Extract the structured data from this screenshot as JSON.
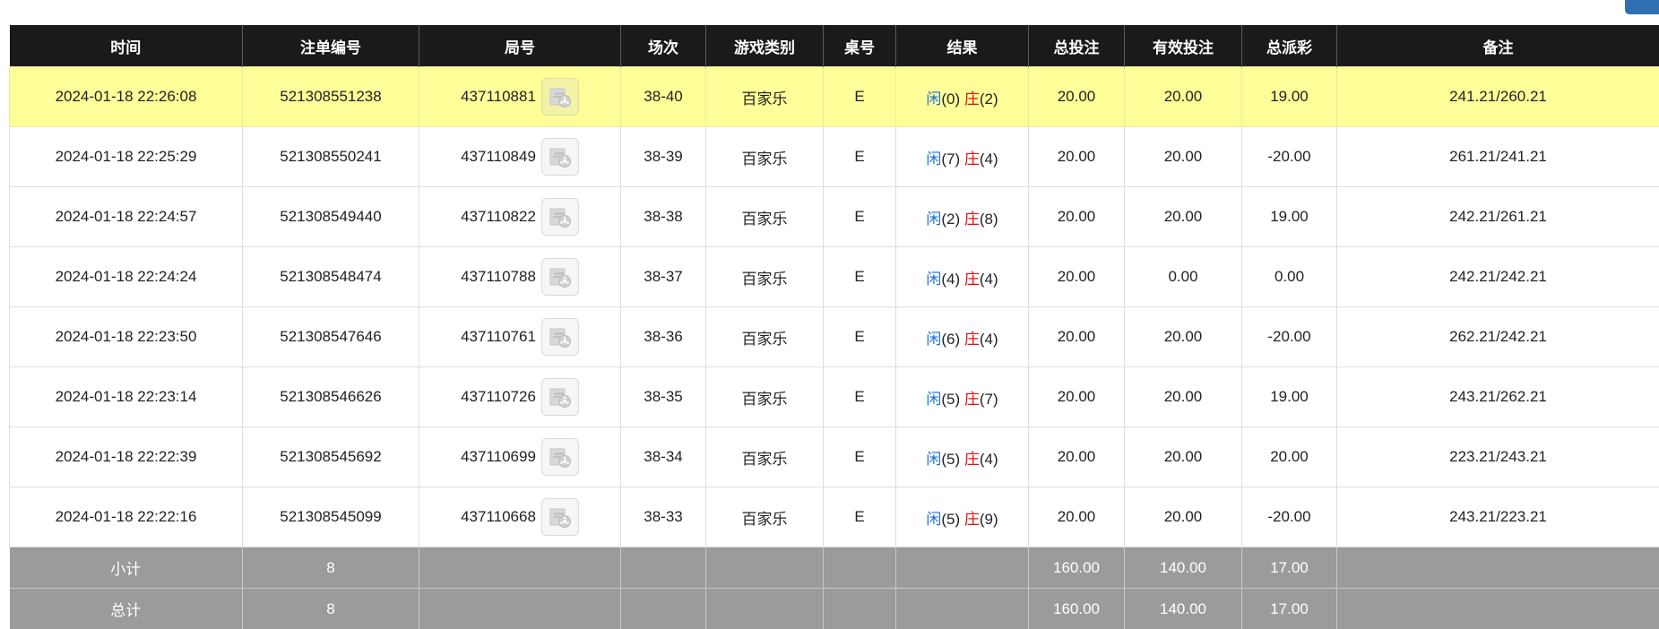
{
  "headers": [
    "时间",
    "注单编号",
    "局号",
    "场次",
    "游戏类别",
    "桌号",
    "结果",
    "总投注",
    "有效投注",
    "总派彩",
    "备注"
  ],
  "icons": {
    "replay": "video-replay-icon"
  },
  "colors": {
    "header_bg": "#1a1a1a",
    "highlight_row": "#ffff99",
    "footer_bg": "#9b9b9b",
    "blue": "#1d6fd6",
    "red": "#e01010"
  },
  "rows": [
    {
      "time": "2024-01-18 22:26:08",
      "bet_id": "521308551238",
      "round": "437110881",
      "session": "38-40",
      "game": "百家乐",
      "table": "E",
      "player_label": "闲",
      "player_score": "(0)",
      "banker_label": "庄",
      "banker_score": "(2)",
      "total_bet": "20.00",
      "valid_bet": "20.00",
      "payout": "19.00",
      "payout_negative": false,
      "note": "241.21/260.21",
      "highlight": true
    },
    {
      "time": "2024-01-18 22:25:29",
      "bet_id": "521308550241",
      "round": "437110849",
      "session": "38-39",
      "game": "百家乐",
      "table": "E",
      "player_label": "闲",
      "player_score": "(7)",
      "banker_label": "庄",
      "banker_score": "(4)",
      "total_bet": "20.00",
      "valid_bet": "20.00",
      "payout": "-20.00",
      "payout_negative": true,
      "note": "261.21/241.21",
      "highlight": false
    },
    {
      "time": "2024-01-18 22:24:57",
      "bet_id": "521308549440",
      "round": "437110822",
      "session": "38-38",
      "game": "百家乐",
      "table": "E",
      "player_label": "闲",
      "player_score": "(2)",
      "banker_label": "庄",
      "banker_score": "(8)",
      "total_bet": "20.00",
      "valid_bet": "20.00",
      "payout": "19.00",
      "payout_negative": false,
      "note": "242.21/261.21",
      "highlight": false
    },
    {
      "time": "2024-01-18 22:24:24",
      "bet_id": "521308548474",
      "round": "437110788",
      "session": "38-37",
      "game": "百家乐",
      "table": "E",
      "player_label": "闲",
      "player_score": "(4)",
      "banker_label": "庄",
      "banker_score": "(4)",
      "total_bet": "20.00",
      "valid_bet": "0.00",
      "payout": "0.00",
      "payout_negative": false,
      "note": "242.21/242.21",
      "highlight": false
    },
    {
      "time": "2024-01-18 22:23:50",
      "bet_id": "521308547646",
      "round": "437110761",
      "session": "38-36",
      "game": "百家乐",
      "table": "E",
      "player_label": "闲",
      "player_score": "(6)",
      "banker_label": "庄",
      "banker_score": "(4)",
      "total_bet": "20.00",
      "valid_bet": "20.00",
      "payout": "-20.00",
      "payout_negative": true,
      "note": "262.21/242.21",
      "highlight": false
    },
    {
      "time": "2024-01-18 22:23:14",
      "bet_id": "521308546626",
      "round": "437110726",
      "session": "38-35",
      "game": "百家乐",
      "table": "E",
      "player_label": "闲",
      "player_score": "(5)",
      "banker_label": "庄",
      "banker_score": "(7)",
      "total_bet": "20.00",
      "valid_bet": "20.00",
      "payout": "19.00",
      "payout_negative": false,
      "note": "243.21/262.21",
      "highlight": false
    },
    {
      "time": "2024-01-18 22:22:39",
      "bet_id": "521308545692",
      "round": "437110699",
      "session": "38-34",
      "game": "百家乐",
      "table": "E",
      "player_label": "闲",
      "player_score": "(5)",
      "banker_label": "庄",
      "banker_score": "(4)",
      "total_bet": "20.00",
      "valid_bet": "20.00",
      "payout": "20.00",
      "payout_negative": false,
      "note": "223.21/243.21",
      "highlight": false
    },
    {
      "time": "2024-01-18 22:22:16",
      "bet_id": "521308545099",
      "round": "437110668",
      "session": "38-33",
      "game": "百家乐",
      "table": "E",
      "player_label": "闲",
      "player_score": "(5)",
      "banker_label": "庄",
      "banker_score": "(9)",
      "total_bet": "20.00",
      "valid_bet": "20.00",
      "payout": "-20.00",
      "payout_negative": true,
      "note": "243.21/223.21",
      "highlight": false
    }
  ],
  "subtotal": {
    "label": "小计",
    "count": "8",
    "total_bet": "160.00",
    "valid_bet": "140.00",
    "payout": "17.00"
  },
  "total": {
    "label": "总计",
    "count": "8",
    "total_bet": "160.00",
    "valid_bet": "140.00",
    "payout": "17.00"
  }
}
